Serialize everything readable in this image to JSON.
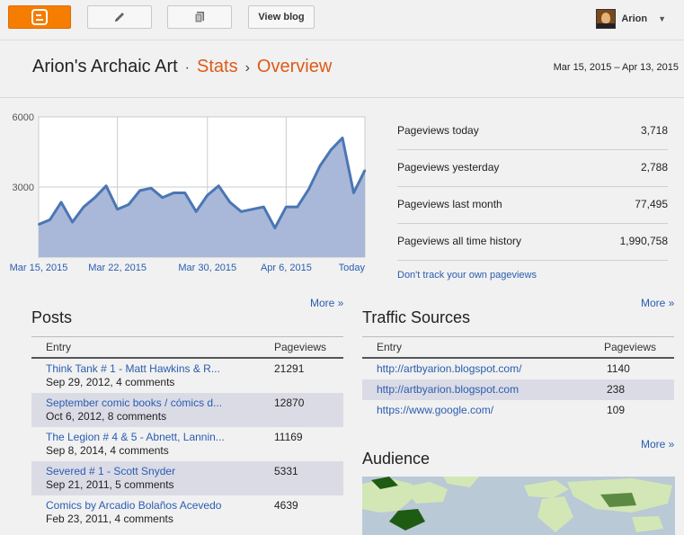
{
  "topbar": {
    "blogger_icon": "blogger-logo-icon",
    "pencil_icon": "pencil-icon",
    "pages_icon": "pages-icon",
    "view_blog_label": "View blog",
    "user_name": "Arion",
    "caret": "▼"
  },
  "header": {
    "blog_name": "Arion's Archaic Art",
    "sep1": "·",
    "stats": "Stats",
    "sep2": "›",
    "overview": "Overview",
    "date_range": "Mar 15, 2015 – Apr 13, 2015"
  },
  "chart_data": {
    "type": "area",
    "title": "",
    "x_tick_labels": [
      "Mar 15, 2015",
      "Mar 22, 2015",
      "Mar 30, 2015",
      "Apr 6, 2015",
      "Today"
    ],
    "y_tick_labels": [
      "6000",
      "3000"
    ],
    "ylim": [
      0,
      6000
    ],
    "grid": true,
    "series": [
      {
        "values": [
          1400,
          1600,
          2350,
          1500,
          2150,
          2550,
          3050,
          2050,
          2250,
          2850,
          2950,
          2550,
          2750,
          2750,
          1950,
          2650,
          3050,
          2350,
          1950,
          2050,
          2150,
          1250,
          2150,
          2150,
          2900,
          3900,
          4600,
          5100,
          2750,
          3718
        ]
      }
    ],
    "colors": {
      "line": "#4a76b4",
      "fill": "#a9b8d8"
    }
  },
  "stats": {
    "rows": [
      {
        "label": "Pageviews today",
        "value": "3,718"
      },
      {
        "label": "Pageviews yesterday",
        "value": "2,788"
      },
      {
        "label": "Pageviews last month",
        "value": "77,495"
      },
      {
        "label": "Pageviews all time history",
        "value": "1,990,758"
      }
    ],
    "dont_track": "Don't track your own pageviews"
  },
  "posts": {
    "more": "More »",
    "title": "Posts",
    "col_entry": "Entry",
    "col_pageviews": "Pageviews",
    "rows": [
      {
        "title": "Think Tank # 1 - Matt Hawkins & R...",
        "meta": "Sep 29, 2012, 4 comments",
        "pv": "21291"
      },
      {
        "title": "September comic books / cómics d...",
        "meta": "Oct 6, 2012, 8 comments",
        "pv": "12870"
      },
      {
        "title": "The Legion # 4 & 5 - Abnett, Lannin...",
        "meta": "Sep 8, 2014, 4 comments",
        "pv": "11169"
      },
      {
        "title": "Severed # 1 - Scott Snyder",
        "meta": "Sep 21, 2011, 5 comments",
        "pv": "5331"
      },
      {
        "title": "Comics by Arcadio Bolaños Acevedo",
        "meta": "Feb 23, 2011, 4 comments",
        "pv": "4639"
      }
    ]
  },
  "traffic": {
    "more": "More »",
    "title": "Traffic Sources",
    "col_entry": "Entry",
    "col_pageviews": "Pageviews",
    "rows": [
      {
        "url": "http://artbyarion.blogspot.com/",
        "pv": "1140"
      },
      {
        "url": "http://artbyarion.blogspot.com",
        "pv": "238"
      },
      {
        "url": "https://www.google.com/",
        "pv": "109"
      }
    ]
  },
  "audience": {
    "more": "More »",
    "title": "Audience",
    "map_colors": {
      "ocean": "#b9c9d6",
      "land": "#d3e7b6",
      "top": "#1e5b13",
      "mid": "#5c8a43"
    }
  }
}
